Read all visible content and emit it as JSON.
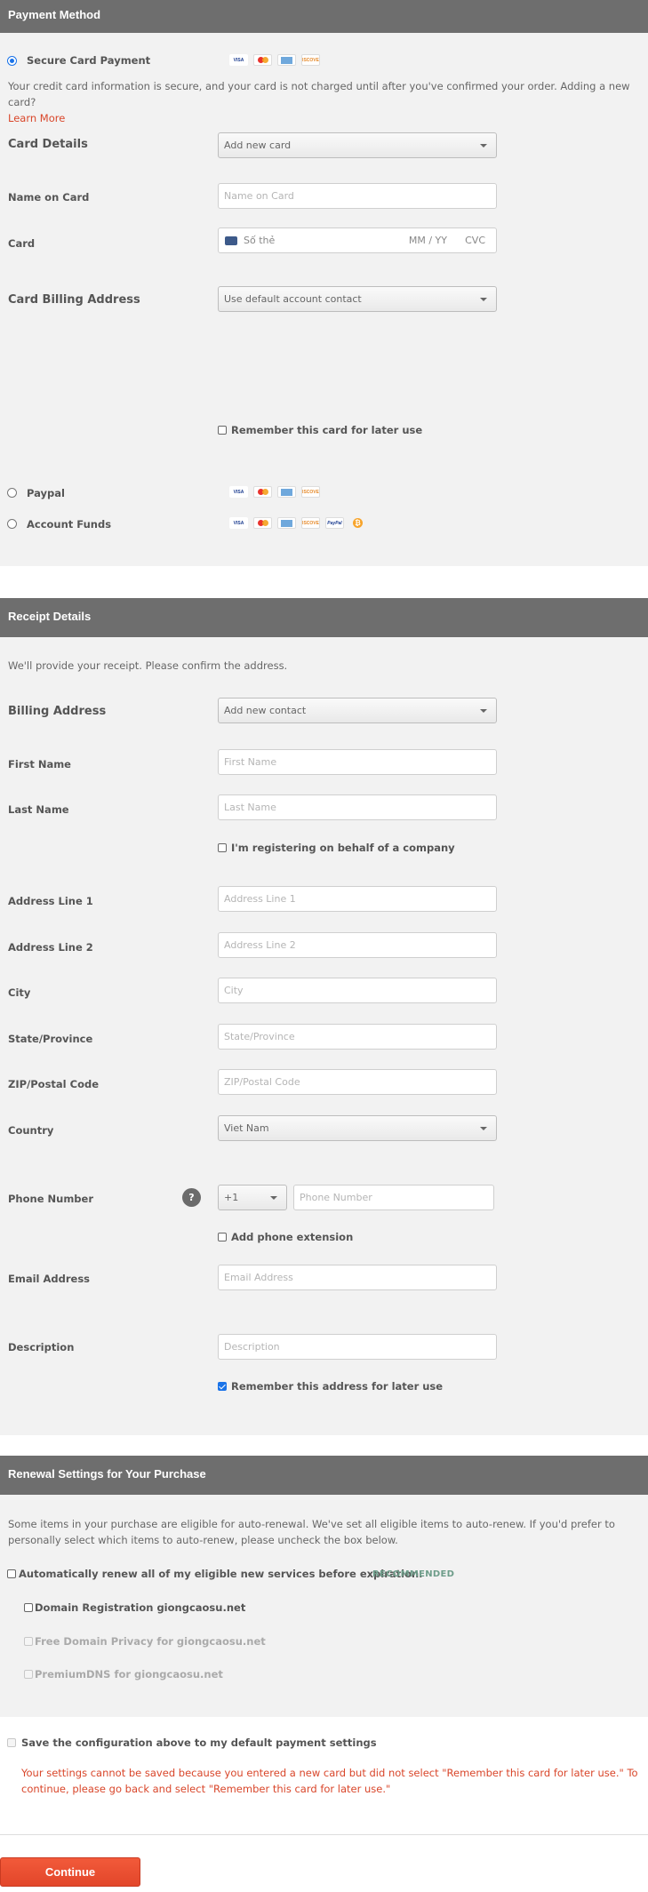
{
  "payment": {
    "header": "Payment Method",
    "secure_card_label": "Secure Card Payment",
    "info_text": "Your credit card information is secure, and your card is not charged until after you've confirmed your order. Adding a new card?",
    "learn_more": "Learn More",
    "card_details_label": "Card Details",
    "card_details_value": "Add new card",
    "name_on_card_label": "Name on Card",
    "name_on_card_placeholder": "Name on Card",
    "card_label": "Card",
    "card_number_placeholder": "Số thẻ",
    "card_expiry_placeholder": "MM / YY",
    "card_cvc_placeholder": "CVC",
    "billing_address_label": "Card Billing Address",
    "billing_address_value": "Use default account contact",
    "remember_card_label": "Remember this card for later use",
    "paypal_label": "Paypal",
    "account_funds_label": "Account Funds",
    "card_logos": [
      "VISA",
      "MasterCard",
      "AMEX",
      "DISCOVER"
    ],
    "paypal_logo": "PayPal",
    "bitcoin_symbol": "₿"
  },
  "receipt": {
    "header": "Receipt Details",
    "intro": "We'll provide your receipt. Please confirm the address.",
    "billing_address_label": "Billing Address",
    "billing_address_value": "Add new contact",
    "first_name_label": "First Name",
    "first_name_placeholder": "First Name",
    "last_name_label": "Last Name",
    "last_name_placeholder": "Last Name",
    "company_label": "I'm registering on behalf of a company",
    "address1_label": "Address Line 1",
    "address1_placeholder": "Address Line 1",
    "address2_label": "Address Line 2",
    "address2_placeholder": "Address Line 2",
    "city_label": "City",
    "city_placeholder": "City",
    "state_label": "State/Province",
    "state_placeholder": "State/Province",
    "zip_label": "ZIP/Postal Code",
    "zip_placeholder": "ZIP/Postal Code",
    "country_label": "Country",
    "country_value": "Viet Nam",
    "phone_label": "Phone Number",
    "phone_help": "?",
    "phone_code_value": "+1",
    "phone_placeholder": "Phone Number",
    "phone_ext_label": "Add phone extension",
    "email_label": "Email Address",
    "email_placeholder": "Email Address",
    "description_label": "Description",
    "description_placeholder": "Description",
    "remember_address_label": "Remember this address for later use"
  },
  "renewal": {
    "header": "Renewal Settings for Your Purchase",
    "intro": "Some items in your purchase are eligible for auto-renewal. We've set all eligible items to auto-renew. If you'd prefer to personally select which items to auto-renew, please uncheck the box below.",
    "auto_renew_label": "Automatically renew all of my eligible new services before expiration.",
    "recommended": "RECOMMENDED",
    "items": [
      {
        "label": "Domain Registration giongcaosu.net",
        "enabled": true
      },
      {
        "label": "Free Domain Privacy for giongcaosu.net",
        "enabled": false
      },
      {
        "label": "PremiumDNS for giongcaosu.net",
        "enabled": false
      }
    ]
  },
  "save_config": {
    "label": "Save the configuration above to my default payment settings",
    "warning": "Your settings cannot be saved because you entered a new card but did not select \"Remember this card for later use.\" To continue, please go back and select \"Remember this card for later use.\""
  },
  "continue_label": "Continue"
}
